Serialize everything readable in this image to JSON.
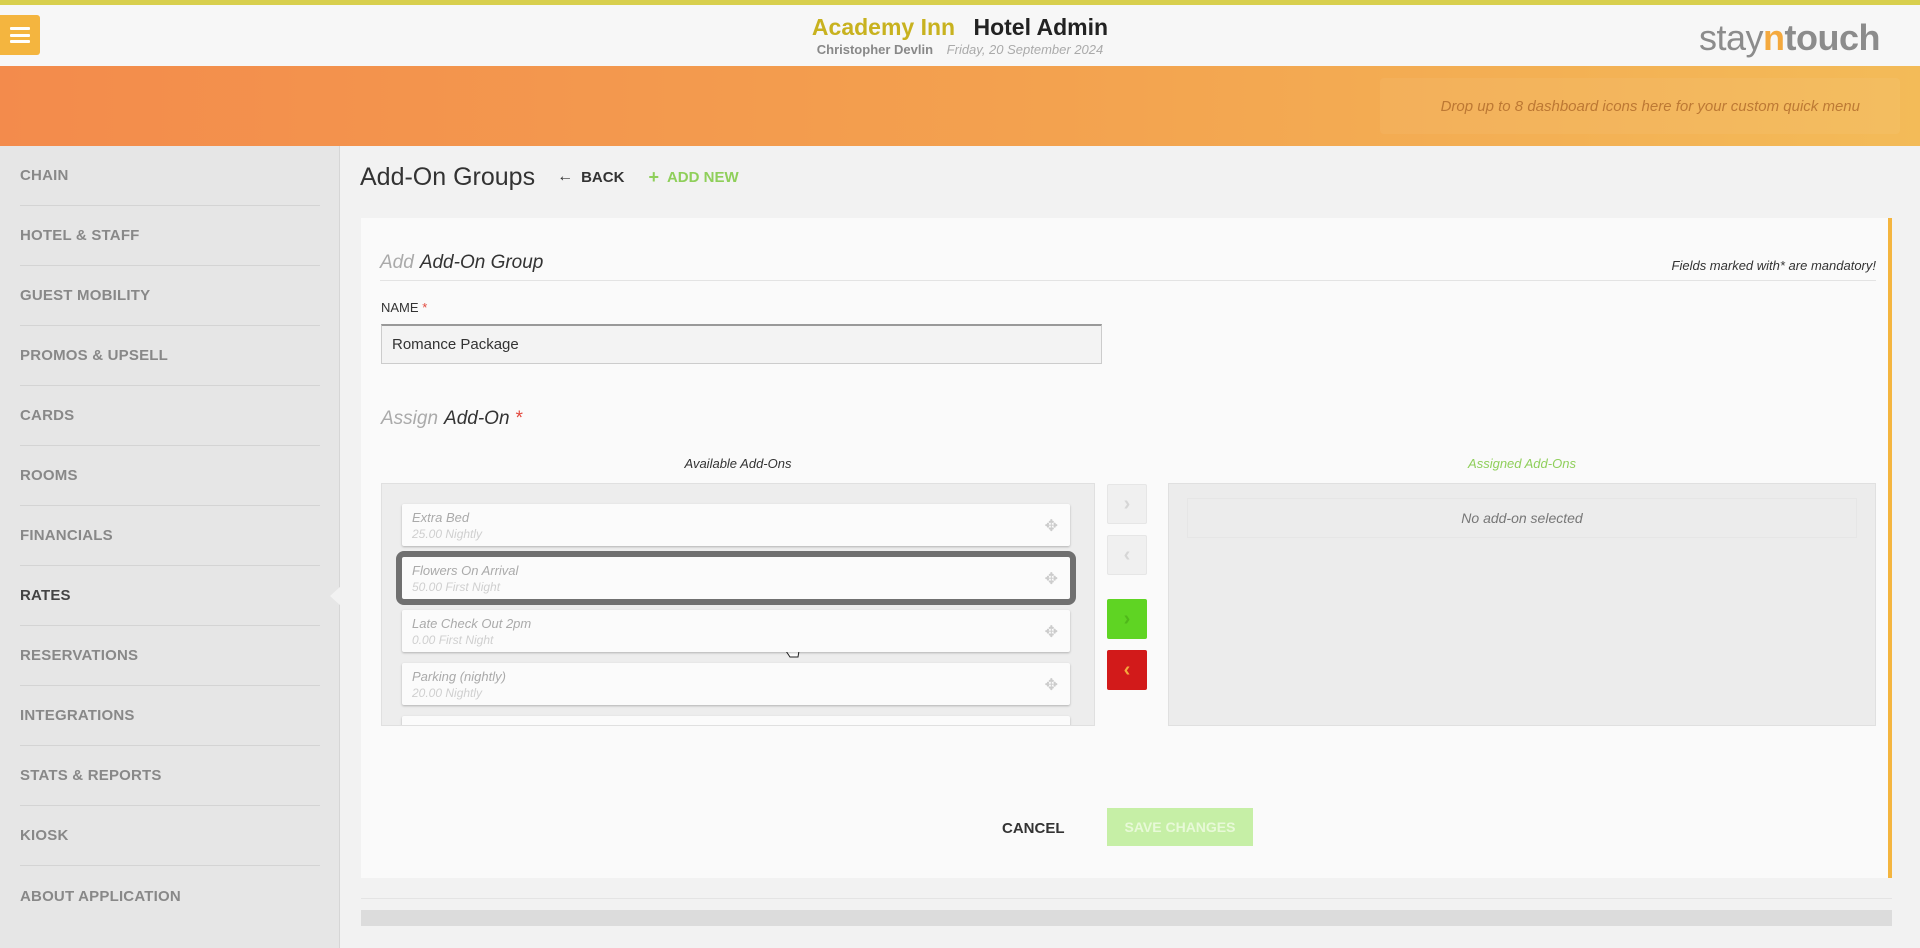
{
  "header": {
    "hotel_name": "Academy Inn",
    "app_name": "Hotel Admin",
    "user_name": "Christopher Devlin",
    "date": "Friday, 20 September 2024",
    "logo": {
      "part1": "stay",
      "part2": "n",
      "part3": "touch"
    }
  },
  "banner": {
    "dropzone_text": "Drop up to 8 dashboard icons here for your custom quick menu"
  },
  "sidebar": {
    "items": [
      {
        "label": "CHAIN"
      },
      {
        "label": "HOTEL & STAFF"
      },
      {
        "label": "GUEST MOBILITY"
      },
      {
        "label": "PROMOS & UPSELL"
      },
      {
        "label": "CARDS"
      },
      {
        "label": "ROOMS"
      },
      {
        "label": "FINANCIALS"
      },
      {
        "label": "RATES",
        "active": true
      },
      {
        "label": "RESERVATIONS"
      },
      {
        "label": "INTEGRATIONS"
      },
      {
        "label": "STATS & REPORTS"
      },
      {
        "label": "KIOSK"
      },
      {
        "label": "ABOUT APPLICATION"
      }
    ]
  },
  "page": {
    "title": "Add-On Groups",
    "back_label": "BACK",
    "add_new_label": "ADD NEW"
  },
  "form": {
    "head_lead": "Add",
    "head_main": "Add-On Group",
    "mandatory_note": "Fields marked with* are mandatory!",
    "name_label": "NAME",
    "required_mark": "*",
    "name_value": "Romance Package",
    "assign_lead": "Assign",
    "assign_main": "Add-On",
    "available_title": "Available Add-Ons",
    "assigned_title": "Assigned Add-Ons",
    "available_addons": [
      {
        "name": "Extra Bed",
        "price": "25.00 Nightly"
      },
      {
        "name": "Flowers On Arrival",
        "price": "50.00 First Night",
        "selected": true
      },
      {
        "name": "Late Check Out 2pm",
        "price": "0.00 First Night"
      },
      {
        "name": "Parking (nightly)",
        "price": "20.00 Nightly"
      }
    ],
    "assigned_empty": "No add-on selected",
    "cancel_label": "CANCEL",
    "save_label": "SAVE CHANGES"
  },
  "colors": {
    "accent_orange": "#f4b53f",
    "hotel_name": "#c8b21f",
    "green": "#8fcf5a",
    "required_red": "#e2483d"
  }
}
